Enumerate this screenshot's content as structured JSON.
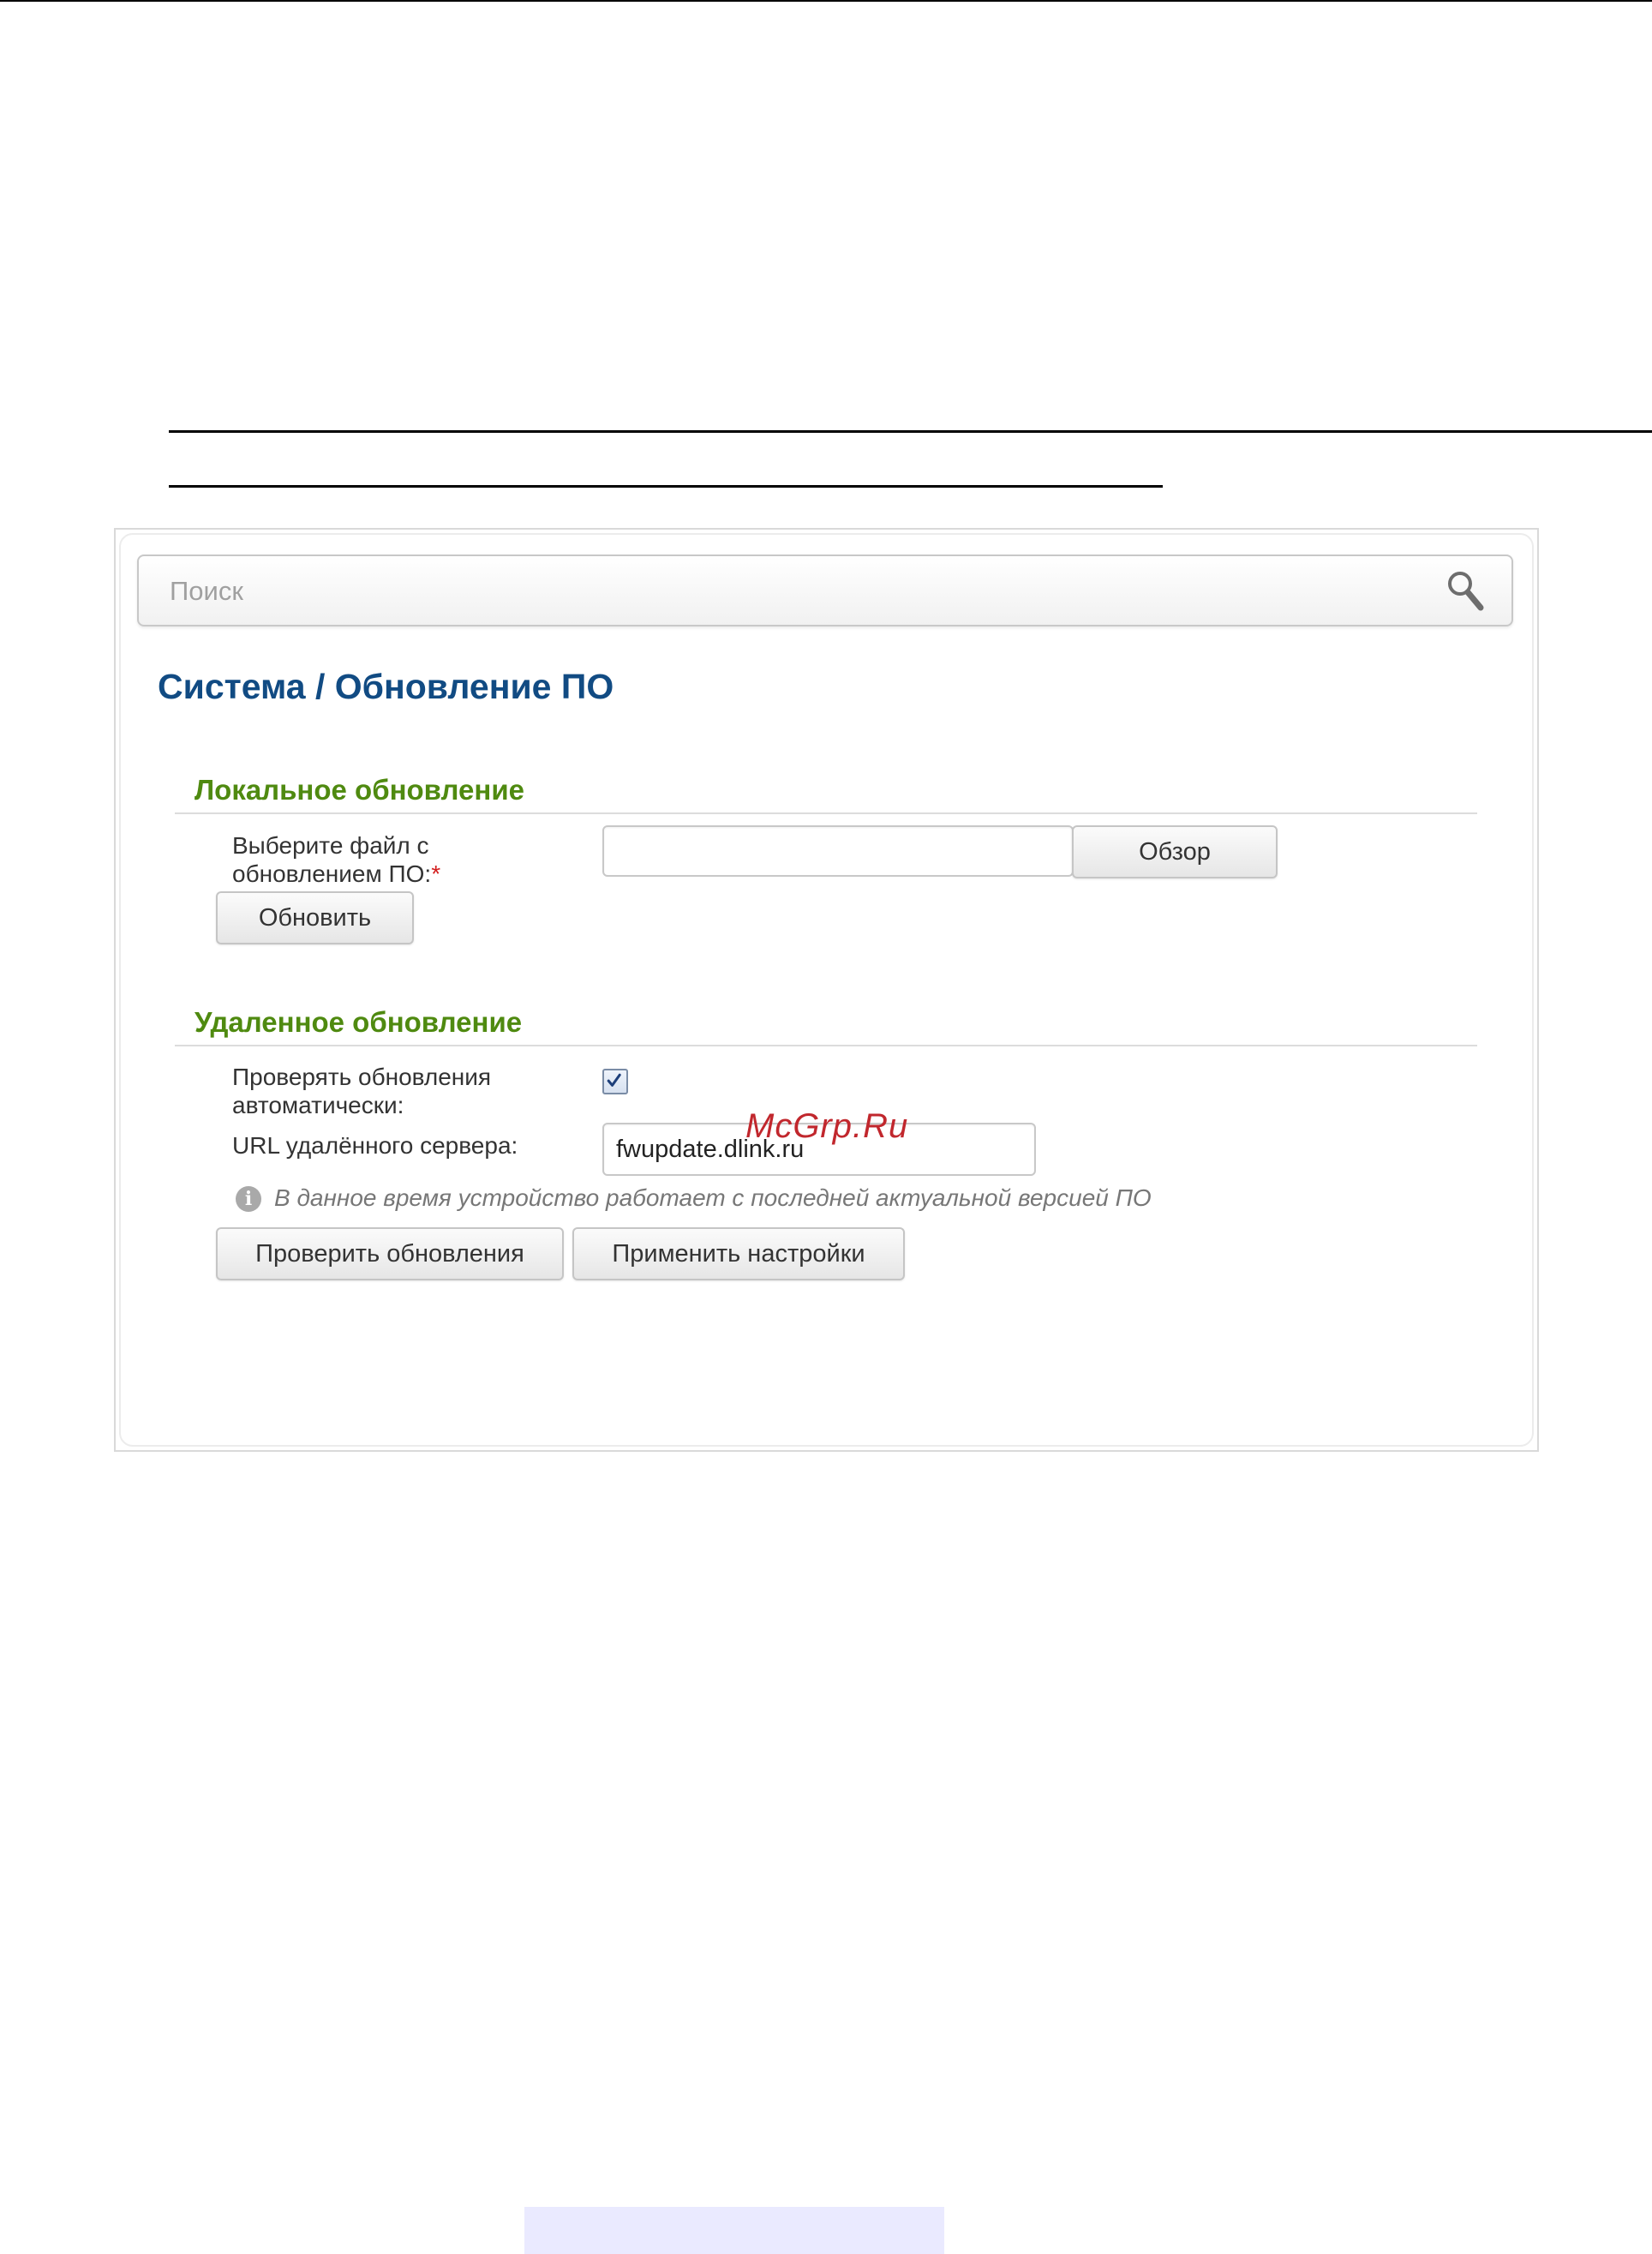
{
  "search": {
    "placeholder": "Поиск",
    "icon": "search-icon"
  },
  "page_title": "Система /  Обновление ПО",
  "local_update": {
    "title": "Локальное обновление",
    "file_label_line1": "Выберите файл с",
    "file_label_line2": "обновлением ПО:",
    "required_mark": "*",
    "browse_label": "Обзор",
    "update_label": "Обновить"
  },
  "remote_update": {
    "title": "Удаленное обновление",
    "auto_check_label_line1": "Проверять обновления",
    "auto_check_label_line2": "автоматически:",
    "auto_check_checked": true,
    "url_label": "URL удалённого сервера:",
    "url_value": "fwupdate.dlink.ru",
    "info_text": "В данное время устройство работает с последней актуальной версией ПО",
    "info_icon": "info-icon",
    "check_updates_label": "Проверить обновления",
    "apply_label": "Применить настройки"
  },
  "watermark": "McGrp.Ru",
  "colors": {
    "title": "#114b83",
    "section": "#4f8a10",
    "required": "#d31e1e",
    "watermark": "#c1272d"
  }
}
